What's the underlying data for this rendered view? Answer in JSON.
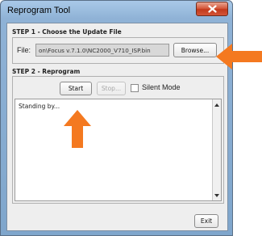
{
  "window": {
    "title": "Reprogram Tool"
  },
  "step1": {
    "heading": "STEP 1 - Choose the Update File",
    "file_label": "File:",
    "file_value": "on\\Focus v.7.1.0\\NC2000_V710_ISP.bin",
    "browse_label": "Browse..."
  },
  "step2": {
    "heading": "STEP 2 - Reprogram",
    "start_label": "Start",
    "stop_label": "Stop...",
    "silent_mode_label": "Silent Mode",
    "silent_mode_checked": false,
    "log_text": "Standing by..."
  },
  "exit_label": "Exit",
  "colors": {
    "arrow": "#f47920",
    "close_button": "#c8432a",
    "title_bar": "#8fb2d6"
  },
  "icons": [
    "close-icon",
    "scroll-up-icon",
    "scroll-down-icon",
    "arrow-right-annotation",
    "arrow-up-annotation"
  ]
}
